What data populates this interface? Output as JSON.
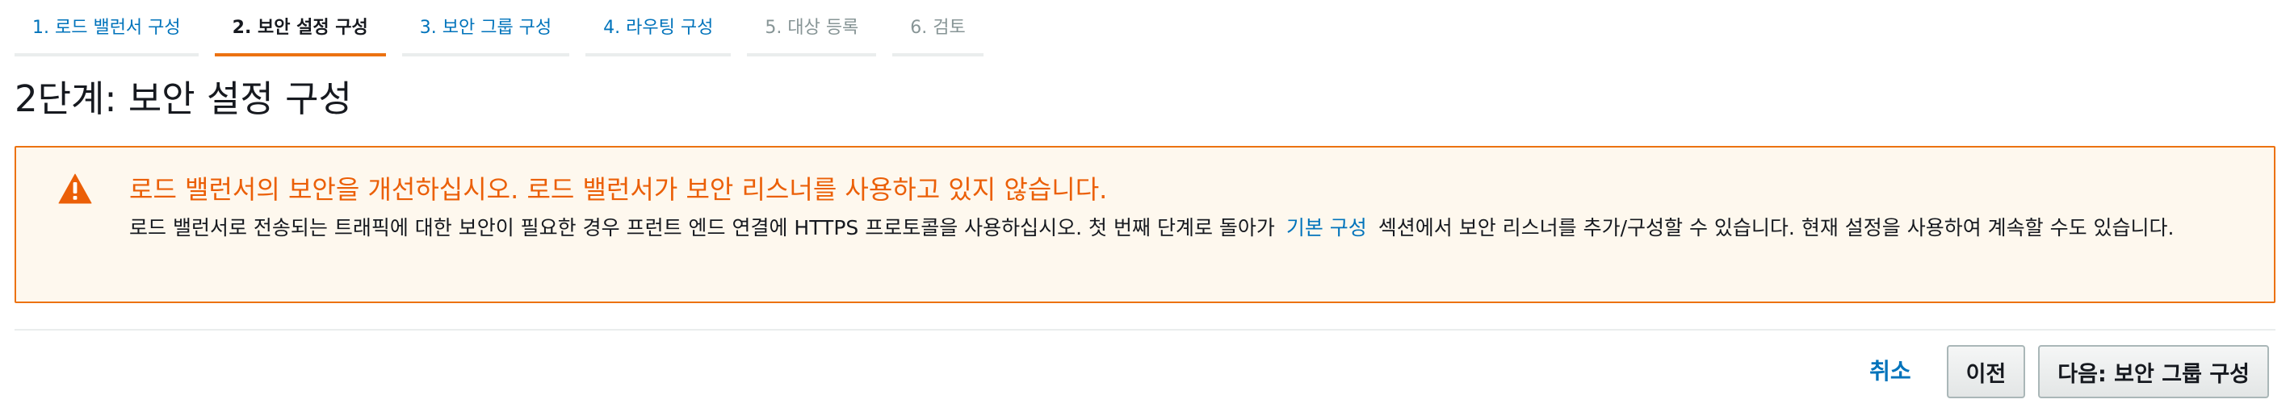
{
  "steps": [
    {
      "label": "1. 로드 밸런서 구성",
      "state": "link"
    },
    {
      "label": "2. 보안 설정 구성",
      "state": "active"
    },
    {
      "label": "3. 보안 그룹 구성",
      "state": "link"
    },
    {
      "label": "4. 라우팅 구성",
      "state": "link"
    },
    {
      "label": "5. 대상 등록",
      "state": "disabled"
    },
    {
      "label": "6. 검토",
      "state": "disabled"
    }
  ],
  "page_title": "2단계: 보안 설정 구성",
  "alert": {
    "type": "warning",
    "icon": "warning-triangle-icon",
    "title": "로드 밸런서의 보안을 개선하십시오. 로드 밸런서가 보안 리스너를 사용하고 있지 않습니다.",
    "body_before": "로드 밸런서로 전송되는 트래픽에 대한 보안이 필요한 경우 프런트 엔드 연결에 HTTPS 프로토콜을 사용하십시오. 첫 번째 단계로 돌아가",
    "body_link": "기본 구성",
    "body_after": "섹션에서 보안 리스너를 추가/구성할 수 있습니다. 현재 설정을 사용하여 계속할 수도 있습니다."
  },
  "actions": {
    "cancel_label": "취소",
    "previous_label": "이전",
    "next_label": "다음: 보안 그룹 구성"
  },
  "colors": {
    "accent": "#ec7211",
    "link": "#0073bb",
    "warning_text": "#eb5f07",
    "warning_bg": "#fef8ee"
  }
}
